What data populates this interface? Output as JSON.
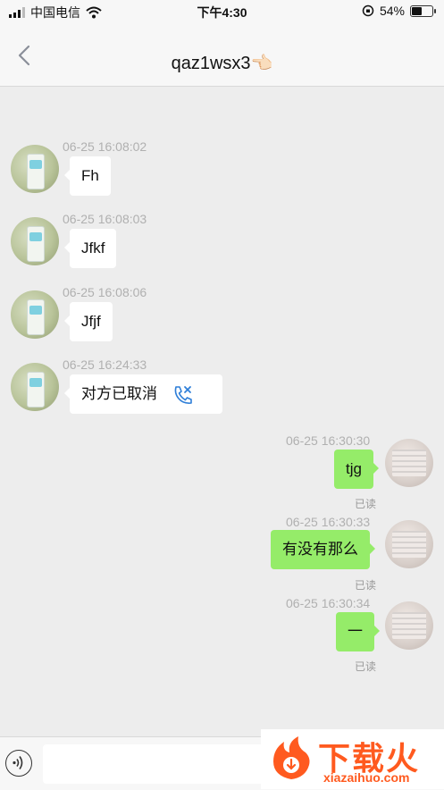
{
  "status_bar": {
    "carrier": "中国电信",
    "time": "下午4:30",
    "battery_percent": "54%",
    "battery_level": 0.54
  },
  "header": {
    "title": "qaz1wsx3👈🏻"
  },
  "colors": {
    "sent_bubble": "#95ec69",
    "received_bubble": "#ffffff",
    "background": "#ededed"
  },
  "messages": [
    {
      "side": "left",
      "timestamp": "06-25 16:08:02",
      "text": "Fh"
    },
    {
      "side": "left",
      "timestamp": "06-25 16:08:03",
      "text": "Jfkf"
    },
    {
      "side": "left",
      "timestamp": "06-25 16:08:06",
      "text": "Jfjf"
    },
    {
      "side": "left",
      "timestamp": "06-25 16:24:33",
      "text": "对方已取消",
      "icon": "voice-call-cancelled-icon"
    },
    {
      "side": "right",
      "timestamp": "06-25 16:30:30",
      "text": "tjg",
      "status": "已读"
    },
    {
      "side": "right",
      "timestamp": "06-25 16:30:33",
      "text": "有没有那么",
      "status": "已读"
    },
    {
      "side": "right",
      "timestamp": "06-25 16:30:34",
      "text": "一",
      "status": "已读"
    }
  ],
  "watermark": {
    "brand": "下载火",
    "domain": "xiazaihuo.com"
  }
}
